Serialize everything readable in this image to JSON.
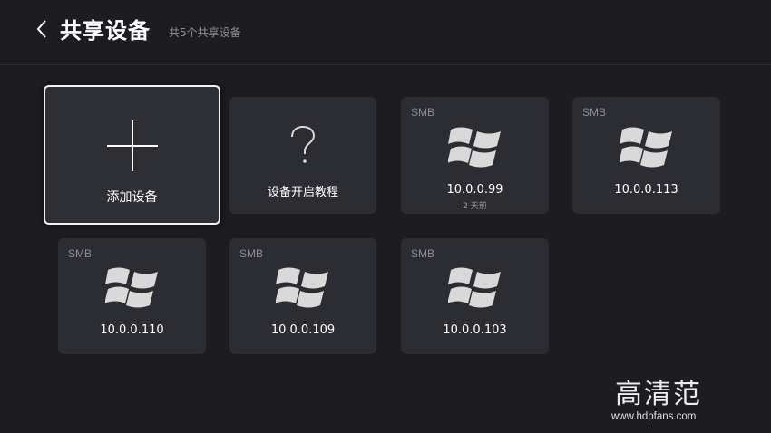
{
  "header": {
    "title": "共享设备",
    "subtitle": "共5个共享设备",
    "back_icon": "chevron-left-icon"
  },
  "cards": {
    "add": {
      "label": "添加设备",
      "icon": "plus-icon"
    },
    "tutorial": {
      "label": "设备开启教程",
      "icon": "question-icon"
    },
    "devices": [
      {
        "protocol": "SMB",
        "ip": "10.0.0.99",
        "last_seen": "2 天前",
        "icon": "windows-icon"
      },
      {
        "protocol": "SMB",
        "ip": "10.0.0.113",
        "icon": "windows-icon"
      },
      {
        "protocol": "SMB",
        "ip": "10.0.0.110",
        "icon": "windows-icon"
      },
      {
        "protocol": "SMB",
        "ip": "10.0.0.109",
        "icon": "windows-icon"
      },
      {
        "protocol": "SMB",
        "ip": "10.0.0.103",
        "icon": "windows-icon"
      }
    ]
  },
  "watermark": {
    "logo_text": "高清范",
    "url": "www.hdpfans.com"
  },
  "colors": {
    "background": "#1c1c21",
    "card": "#2c2c33",
    "focus_border": "#f2f2f2",
    "icon": "#d9d9d9"
  }
}
